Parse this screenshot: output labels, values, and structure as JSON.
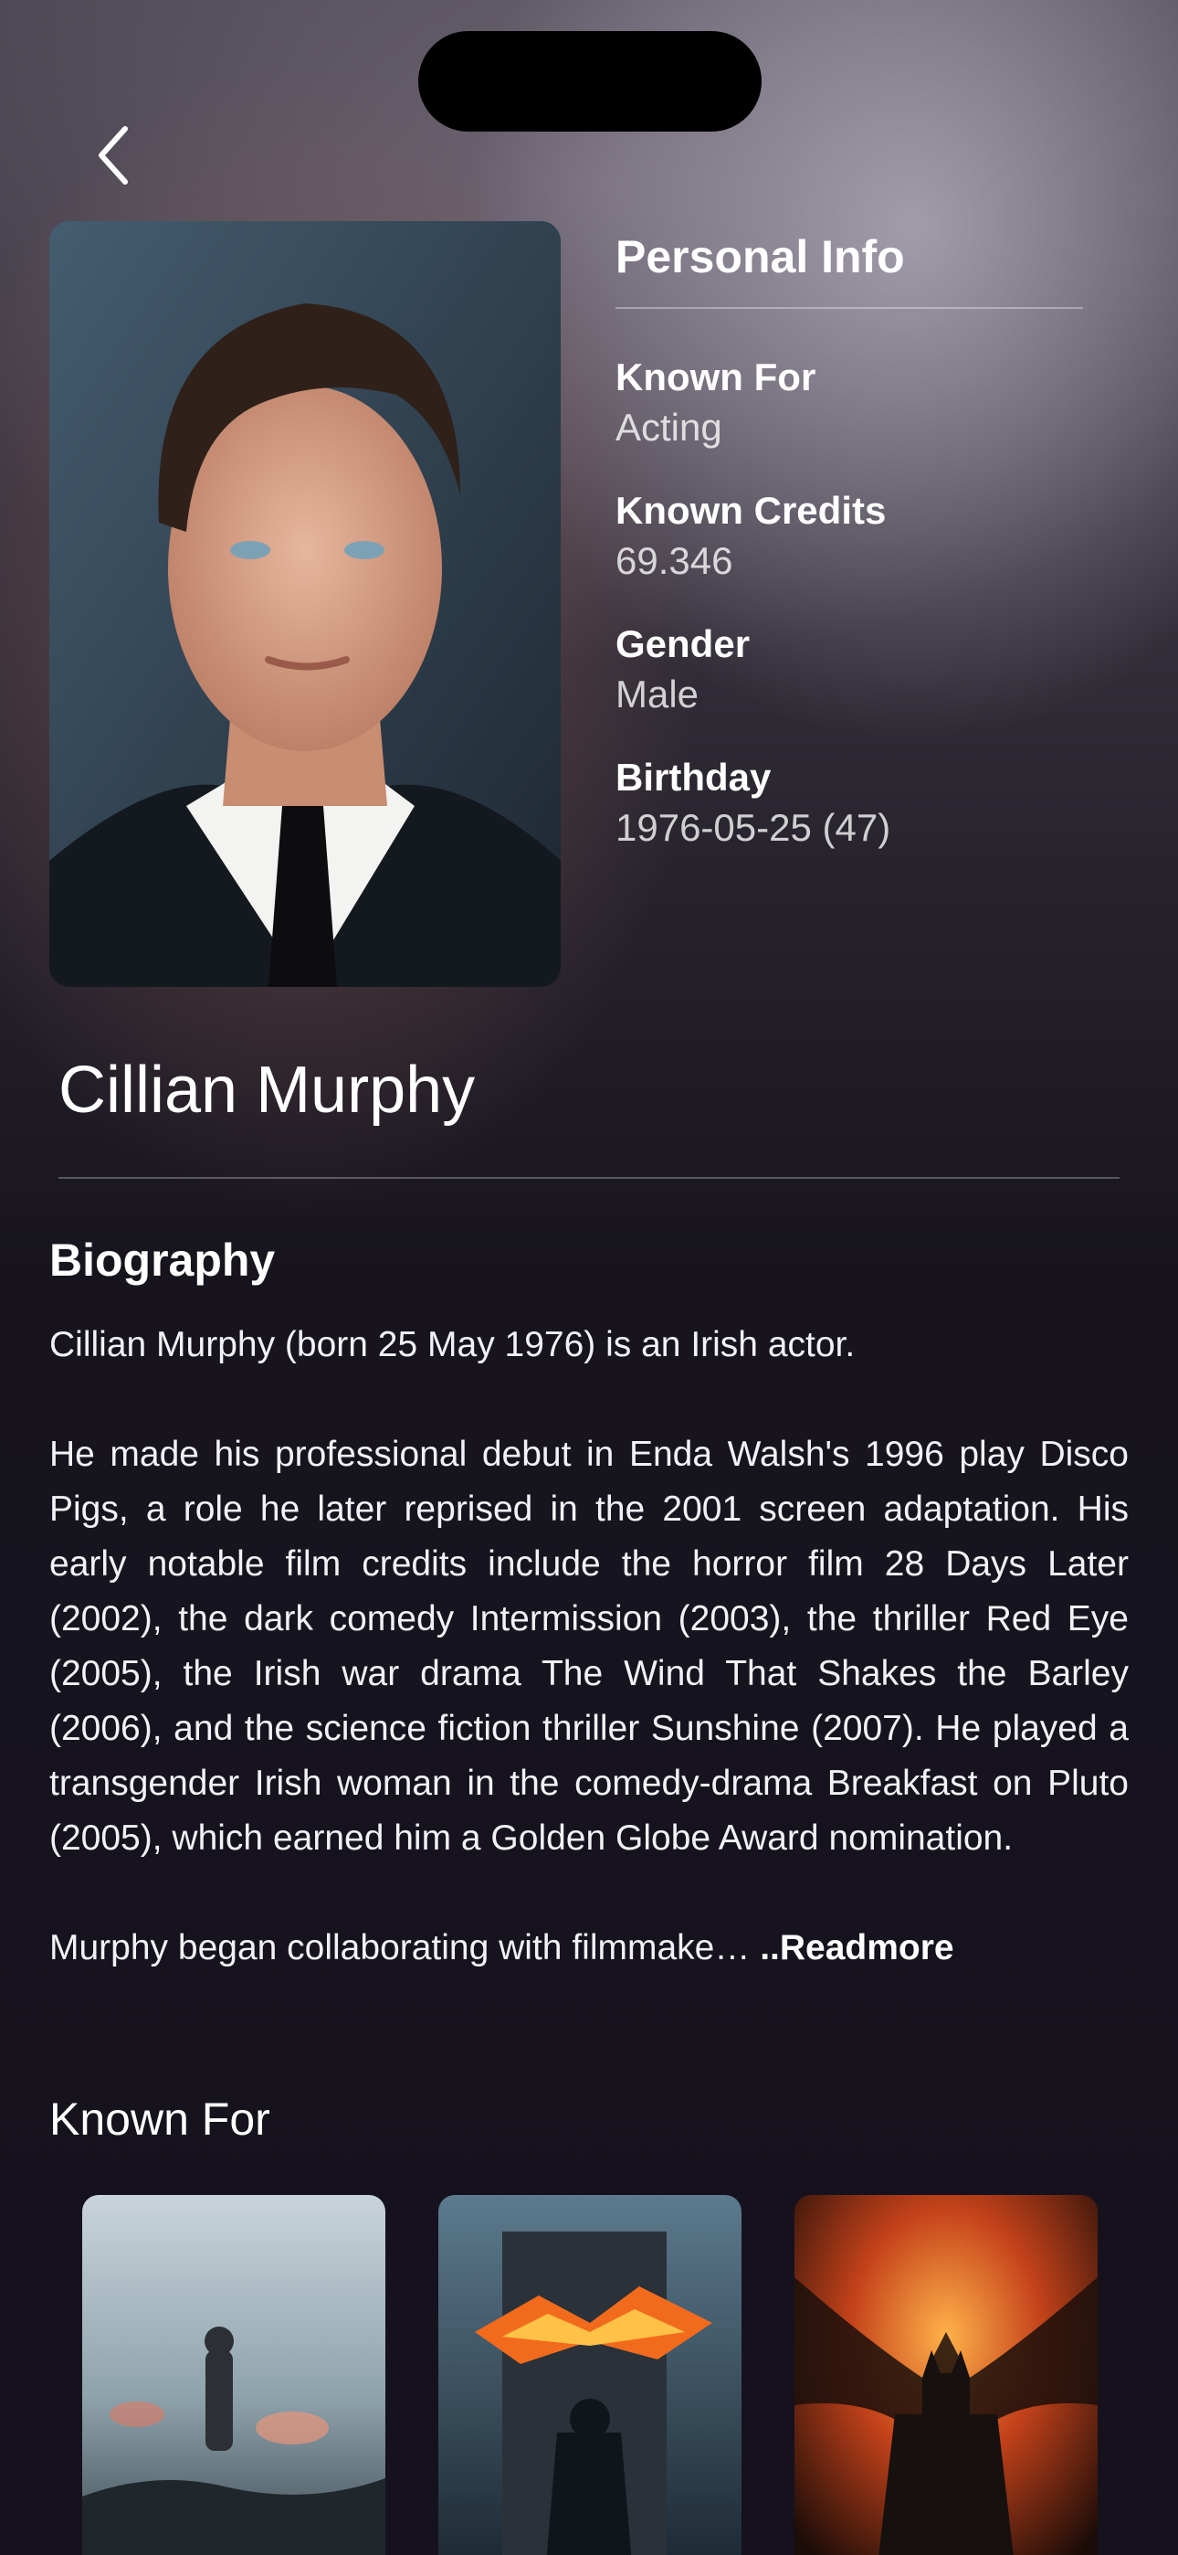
{
  "person": {
    "name": "Cillian Murphy"
  },
  "personal_info": {
    "title": "Personal Info",
    "items": [
      {
        "label": "Known For",
        "value": "Acting"
      },
      {
        "label": "Known Credits",
        "value": "69.346"
      },
      {
        "label": "Gender",
        "value": "Male"
      },
      {
        "label": "Birthday",
        "value": "1976-05-25 (47)"
      }
    ]
  },
  "biography": {
    "title": "Biography",
    "paragraphs": [
      "Cillian Murphy (born 25 May 1976) is an Irish actor.",
      "He made his professional debut in Enda Walsh's 1996 play Disco Pigs, a role he later reprised in the 2001 screen adaptation. His early notable film credits include the horror film 28 Days Later (2002), the dark comedy Intermission (2003), the thriller Red Eye (2005), the Irish war drama The Wind That Shakes the Barley (2006), and the science fiction thriller Sunshine (2007). He played a transgender Irish woman in the comedy-drama Breakfast on Pluto (2005), which earned him a Golden Globe Award nomination.",
      "Murphy began collaborating with filmmake… "
    ],
    "readmore_label": "..Readmore"
  },
  "known_for": {
    "title": "Known For"
  },
  "icons": {
    "back": "chevron-left-icon"
  },
  "colors": {
    "background": "#15121d",
    "text": "#ffffff"
  }
}
